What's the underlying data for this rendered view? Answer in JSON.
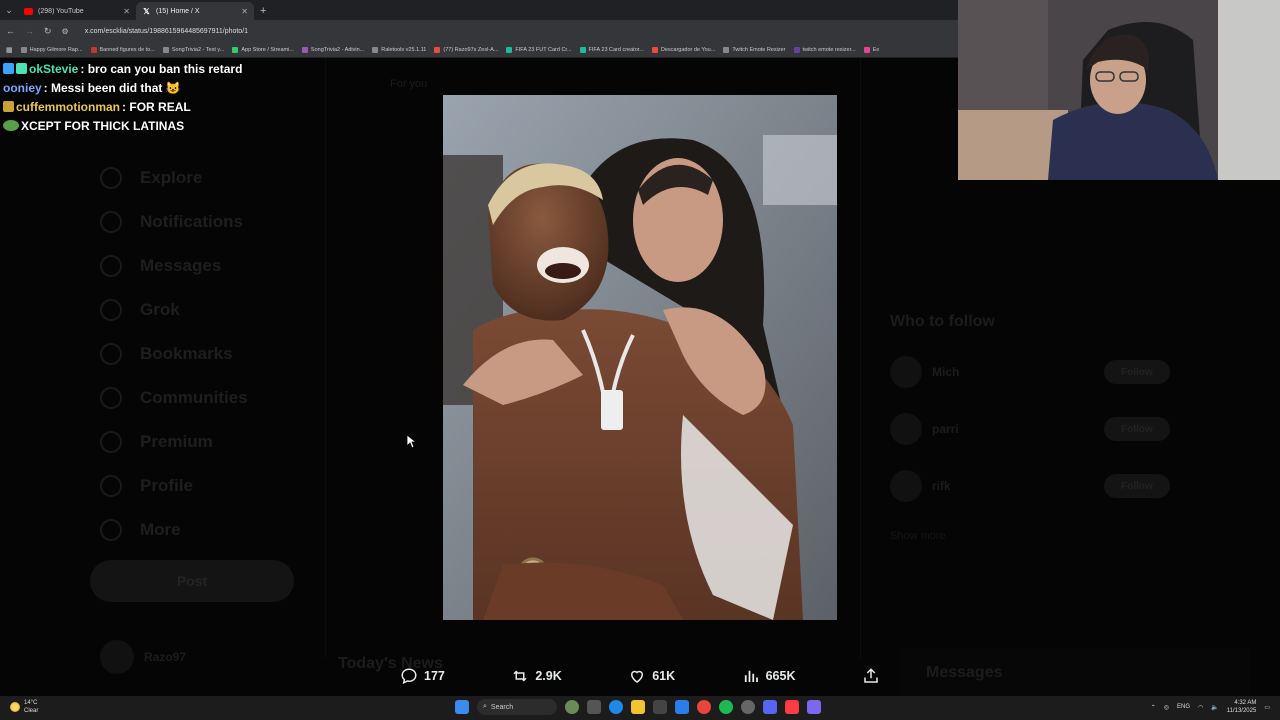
{
  "browser": {
    "tabs": [
      {
        "title": "(298) YouTube",
        "icon": "youtube-icon",
        "active": false
      },
      {
        "title": "(15) Home / X",
        "icon": "x-logo-icon",
        "active": true
      }
    ],
    "url": "x.com/escklia/status/1988615964485697911/photo/1",
    "bookmarks": [
      "Happy Gilmore Rap...",
      "Banned figures de to...",
      "SongTrivia2 - Test y...",
      "App Store / Streami...",
      "SongTrivia2 - Adivin...",
      "Raletools v25.1.11",
      "(77) Razo97s Zesl-A...",
      "FIFA 23 FUT Card Cr...",
      "FIFA 23 Card creator...",
      "Descargador de You...",
      "Twitch Emote Resizer",
      "twitch emote resizer...",
      "Es"
    ]
  },
  "chat": [
    {
      "user": "okStevie",
      "user_color": "#4fe0b5",
      "message": "bro can you ban this retard",
      "badge_color": "#3aa3ff"
    },
    {
      "user": "ooniey",
      "user_color": "#7aa8ff",
      "message": "Messi been did that 😺",
      "badge_color": ""
    },
    {
      "user": "cuffemmotionman",
      "user_color": "#e8c75a",
      "message": "FOR REAL",
      "badge_color": "#c9a23a"
    },
    {
      "user": "",
      "user_color": "#ffffff",
      "message": "XCEPT FOR THICK LATINAS",
      "badge_color": "#5a9e4a"
    }
  ],
  "background_page": {
    "feed_tab": "For you",
    "sidebar": [
      "Explore",
      "Notifications",
      "Messages",
      "Grok",
      "Bookmarks",
      "Communities",
      "Premium",
      "Profile",
      "More"
    ],
    "post_button": "Post",
    "profile_name": "Razo97",
    "news_heading": "Today's News",
    "who_to_follow": "Who to follow",
    "follow_suggestions": [
      {
        "name": "Mich",
        "button": "Follow"
      },
      {
        "name": "parri",
        "button": "Follow"
      },
      {
        "name": "rifk",
        "button": "Follow"
      }
    ],
    "show_more": "Show more",
    "messages_panel": "Messages"
  },
  "post_actions": {
    "replies": "177",
    "reposts": "2.9K",
    "likes": "61K",
    "views": "665K"
  },
  "taskbar": {
    "temperature": "14°C",
    "condition": "Clear",
    "search_label": "Search",
    "language": "ENG",
    "time": "4:32 AM",
    "date": "11/13/2025"
  }
}
